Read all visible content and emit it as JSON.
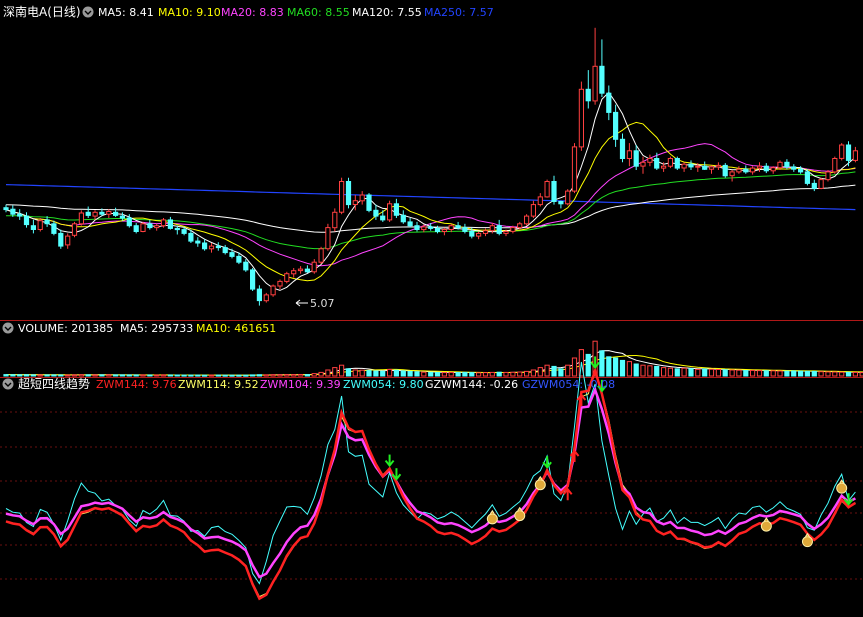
{
  "panels": {
    "price": {
      "title": "深南电A(日线)",
      "indicators": [
        {
          "label": "MA5: ",
          "value": "8.41",
          "color": "#ffffff"
        },
        {
          "label": "MA10: ",
          "value": "9.10",
          "color": "#ffff00"
        },
        {
          "label": "MA20: ",
          "value": "8.83",
          "color": "#ff44ff"
        },
        {
          "label": "MA60: ",
          "value": "8.55",
          "color": "#22dd22"
        },
        {
          "label": "MA120: ",
          "value": "7.55",
          "color": "#ffffff"
        },
        {
          "label": "MA250: ",
          "value": "7.57",
          "color": "#2244ff"
        }
      ],
      "low_marker": "5.07"
    },
    "volume": {
      "indicators": [
        {
          "label": "VOLUME: ",
          "value": "201385",
          "color": "#ffffff"
        },
        {
          "label": "MA5: ",
          "value": "295733",
          "color": "#ffffff"
        },
        {
          "label": "MA10: ",
          "value": "461651",
          "color": "#ffff00"
        }
      ]
    },
    "indicator": {
      "title": "超短四线趋势",
      "indicators": [
        {
          "label": "ZWM144: ",
          "value": "9.76",
          "color": "#ff2222"
        },
        {
          "label": "ZWM114: ",
          "value": "9.52",
          "color": "#ffff66"
        },
        {
          "label": "ZWM104: ",
          "value": "9.39",
          "color": "#ff44ff"
        },
        {
          "label": "ZWM054: ",
          "value": "9.80",
          "color": "#44ffff"
        },
        {
          "label": "GZWM144: ",
          "value": "-0.26",
          "color": "#ffffff"
        },
        {
          "label": "GZWM054: ",
          "value": "-0.08",
          "color": "#3355ff"
        }
      ]
    }
  },
  "colors": {
    "up": "#ff4040",
    "down": "#54ffff",
    "separator": "#b01818",
    "grid": "#6a0f0f",
    "background": "#000000"
  },
  "icons": {
    "panel_toggle": "chevron-circle-icon",
    "buy_arrow": "red-up-arrow-icon",
    "sell_arrow": "green-down-arrow-icon",
    "money_bag": "money-bag-icon"
  },
  "chart_data": [
    {
      "type": "candlestick",
      "series": [
        {
          "name": "MA5",
          "color": "#ffffff"
        },
        {
          "name": "MA10",
          "color": "#ffff00"
        },
        {
          "name": "MA20",
          "color": "#ff44ff"
        },
        {
          "name": "MA60",
          "color": "#22dd22"
        },
        {
          "name": "MA120",
          "color": "#ffffff"
        },
        {
          "name": "MA250",
          "color": "#2244ff"
        }
      ],
      "ylim": [
        4.8,
        12.4
      ],
      "ohlc": [
        [
          7.62,
          7.7,
          7.5,
          7.57
        ],
        [
          7.58,
          7.68,
          7.38,
          7.45
        ],
        [
          7.45,
          7.58,
          7.3,
          7.4
        ],
        [
          7.4,
          7.5,
          7.1,
          7.18
        ],
        [
          7.15,
          7.3,
          6.95,
          7.05
        ],
        [
          7.05,
          7.35,
          7.0,
          7.28
        ],
        [
          7.3,
          7.4,
          7.12,
          7.2
        ],
        [
          7.2,
          7.28,
          6.9,
          6.95
        ],
        [
          6.95,
          7.05,
          6.55,
          6.62
        ],
        [
          6.65,
          6.95,
          6.55,
          6.88
        ],
        [
          6.9,
          7.25,
          6.85,
          7.2
        ],
        [
          7.2,
          7.55,
          7.15,
          7.48
        ],
        [
          7.5,
          7.65,
          7.35,
          7.42
        ],
        [
          7.4,
          7.55,
          7.3,
          7.5
        ],
        [
          7.5,
          7.6,
          7.4,
          7.45
        ],
        [
          7.45,
          7.58,
          7.35,
          7.52
        ],
        [
          7.5,
          7.62,
          7.38,
          7.42
        ],
        [
          7.4,
          7.5,
          7.28,
          7.35
        ],
        [
          7.35,
          7.45,
          7.1,
          7.15
        ],
        [
          7.15,
          7.22,
          6.95,
          7.0
        ],
        [
          7.0,
          7.25,
          6.98,
          7.2
        ],
        [
          7.2,
          7.3,
          7.05,
          7.1
        ],
        [
          7.1,
          7.2,
          7.02,
          7.15
        ],
        [
          7.15,
          7.35,
          7.1,
          7.3
        ],
        [
          7.3,
          7.38,
          7.05,
          7.08
        ],
        [
          7.08,
          7.15,
          6.92,
          7.05
        ],
        [
          7.05,
          7.12,
          6.9,
          6.95
        ],
        [
          6.95,
          7.05,
          6.7,
          6.75
        ],
        [
          6.75,
          6.85,
          6.6,
          6.7
        ],
        [
          6.7,
          6.8,
          6.5,
          6.55
        ],
        [
          6.55,
          6.7,
          6.45,
          6.62
        ],
        [
          6.62,
          6.72,
          6.5,
          6.58
        ],
        [
          6.58,
          6.65,
          6.4,
          6.45
        ],
        [
          6.45,
          6.55,
          6.3,
          6.35
        ],
        [
          6.35,
          6.45,
          6.15,
          6.2
        ],
        [
          6.2,
          6.28,
          5.95,
          6.0
        ],
        [
          6.0,
          6.05,
          5.45,
          5.5
        ],
        [
          5.5,
          5.6,
          5.07,
          5.2
        ],
        [
          5.2,
          5.4,
          5.15,
          5.35
        ],
        [
          5.35,
          5.62,
          5.3,
          5.58
        ],
        [
          5.58,
          5.75,
          5.5,
          5.7
        ],
        [
          5.7,
          5.95,
          5.65,
          5.9
        ],
        [
          5.9,
          6.05,
          5.8,
          5.98
        ],
        [
          5.98,
          6.1,
          5.9,
          6.02
        ],
        [
          6.02,
          6.12,
          5.92,
          5.95
        ],
        [
          5.95,
          6.28,
          5.9,
          6.2
        ],
        [
          6.2,
          6.6,
          6.15,
          6.55
        ],
        [
          6.55,
          7.2,
          6.5,
          7.1
        ],
        [
          7.1,
          7.6,
          7.0,
          7.5
        ],
        [
          7.5,
          8.4,
          7.45,
          8.3
        ],
        [
          8.3,
          8.4,
          7.6,
          7.7
        ],
        [
          7.7,
          7.95,
          7.55,
          7.8
        ],
        [
          7.8,
          8.05,
          7.7,
          7.95
        ],
        [
          7.95,
          8.0,
          7.5,
          7.55
        ],
        [
          7.55,
          7.7,
          7.3,
          7.4
        ],
        [
          7.4,
          7.55,
          7.25,
          7.3
        ],
        [
          7.3,
          7.8,
          7.25,
          7.72
        ],
        [
          7.72,
          7.85,
          7.35,
          7.42
        ],
        [
          7.42,
          7.55,
          7.2,
          7.25
        ],
        [
          7.25,
          7.35,
          7.1,
          7.15
        ],
        [
          7.15,
          7.25,
          7.0,
          7.05
        ],
        [
          7.05,
          7.18,
          6.98,
          7.12
        ],
        [
          7.12,
          7.22,
          7.02,
          7.08
        ],
        [
          7.08,
          7.15,
          6.95,
          7.0
        ],
        [
          7.0,
          7.1,
          6.9,
          7.05
        ],
        [
          7.05,
          7.2,
          6.98,
          7.15
        ],
        [
          7.15,
          7.25,
          7.05,
          7.1
        ],
        [
          7.1,
          7.2,
          6.95,
          7.0
        ],
        [
          7.0,
          7.1,
          6.82,
          6.88
        ],
        [
          6.88,
          7.0,
          6.8,
          6.95
        ],
        [
          6.95,
          7.08,
          6.88,
          7.02
        ],
        [
          7.02,
          7.22,
          6.95,
          7.15
        ],
        [
          7.15,
          7.3,
          6.9,
          6.95
        ],
        [
          6.95,
          7.05,
          6.88,
          7.0
        ],
        [
          7.0,
          7.15,
          6.95,
          7.1
        ],
        [
          7.1,
          7.25,
          7.05,
          7.2
        ],
        [
          7.2,
          7.45,
          7.15,
          7.4
        ],
        [
          7.4,
          7.8,
          7.35,
          7.7
        ],
        [
          7.7,
          8.0,
          7.65,
          7.9
        ],
        [
          7.9,
          8.35,
          7.88,
          8.3
        ],
        [
          8.3,
          8.45,
          7.7,
          7.78
        ],
        [
          7.78,
          7.8,
          7.6,
          7.72
        ],
        [
          7.72,
          8.1,
          7.68,
          8.05
        ],
        [
          8.05,
          9.3,
          8.0,
          9.2
        ],
        [
          9.2,
          10.9,
          9.1,
          10.7
        ],
        [
          10.7,
          11.2,
          10.2,
          10.4
        ],
        [
          10.4,
          12.3,
          10.3,
          11.3
        ],
        [
          11.3,
          12.0,
          10.5,
          10.6
        ],
        [
          10.6,
          10.8,
          9.9,
          10.1
        ],
        [
          10.1,
          10.3,
          9.2,
          9.4
        ],
        [
          9.4,
          9.55,
          8.8,
          8.9
        ],
        [
          8.9,
          9.3,
          8.7,
          9.1
        ],
        [
          9.1,
          9.25,
          8.6,
          8.7
        ],
        [
          8.7,
          8.95,
          8.5,
          8.8
        ],
        [
          8.8,
          9.0,
          8.7,
          8.9
        ],
        [
          8.9,
          9.05,
          8.6,
          8.65
        ],
        [
          8.65,
          8.8,
          8.55,
          8.7
        ],
        [
          8.7,
          8.95,
          8.65,
          8.9
        ],
        [
          8.9,
          8.95,
          8.6,
          8.65
        ],
        [
          8.65,
          8.8,
          8.55,
          8.75
        ],
        [
          8.75,
          8.85,
          8.6,
          8.68
        ],
        [
          8.68,
          8.78,
          8.55,
          8.7
        ],
        [
          8.7,
          8.82,
          8.6,
          8.62
        ],
        [
          8.62,
          8.72,
          8.5,
          8.68
        ],
        [
          8.68,
          8.8,
          8.6,
          8.72
        ],
        [
          8.72,
          8.78,
          8.4,
          8.45
        ],
        [
          8.45,
          8.6,
          8.3,
          8.55
        ],
        [
          8.55,
          8.7,
          8.5,
          8.62
        ],
        [
          8.62,
          8.72,
          8.5,
          8.55
        ],
        [
          8.55,
          8.7,
          8.48,
          8.65
        ],
        [
          8.65,
          8.8,
          8.55,
          8.7
        ],
        [
          8.7,
          8.78,
          8.52,
          8.58
        ],
        [
          8.58,
          8.7,
          8.5,
          8.66
        ],
        [
          8.66,
          8.85,
          8.6,
          8.8
        ],
        [
          8.8,
          8.88,
          8.62,
          8.68
        ],
        [
          8.68,
          8.75,
          8.55,
          8.62
        ],
        [
          8.62,
          8.7,
          8.5,
          8.55
        ],
        [
          8.55,
          8.62,
          8.2,
          8.25
        ],
        [
          8.25,
          8.35,
          8.05,
          8.12
        ],
        [
          8.12,
          8.4,
          8.1,
          8.35
        ],
        [
          8.35,
          8.6,
          8.3,
          8.55
        ],
        [
          8.55,
          8.95,
          8.5,
          8.9
        ],
        [
          8.9,
          9.3,
          8.85,
          9.25
        ],
        [
          9.25,
          9.35,
          8.7,
          8.85
        ],
        [
          8.85,
          9.2,
          8.8,
          9.1
        ]
      ],
      "ma250_ends": [
        8.22,
        7.57
      ]
    },
    {
      "type": "bar",
      "series": [
        {
          "name": "VOLUME",
          "color": "#ff4040"
        },
        {
          "name": "MA5",
          "color": "#ffffff"
        },
        {
          "name": "MA10",
          "color": "#ffff00"
        }
      ],
      "ylim": [
        0,
        3000000
      ],
      "volumes": [
        120000,
        110000,
        100000,
        105000,
        95000,
        90000,
        88000,
        92000,
        85000,
        80000,
        95000,
        110000,
        100000,
        95000,
        90000,
        98000,
        92000,
        88000,
        85000,
        80000,
        90000,
        85000,
        83000,
        88000,
        86000,
        80000,
        78000,
        75000,
        72000,
        70000,
        75000,
        72000,
        70000,
        68000,
        65000,
        70000,
        90000,
        110000,
        100000,
        105000,
        110000,
        115000,
        120000,
        125000,
        118000,
        200000,
        300000,
        500000,
        700000,
        900000,
        600000,
        500000,
        480000,
        450000,
        420000,
        400000,
        550000,
        480000,
        420000,
        380000,
        350000,
        320000,
        300000,
        290000,
        280000,
        300000,
        290000,
        300000,
        280000,
        270000,
        280000,
        300000,
        320000,
        300000,
        310000,
        330000,
        380000,
        500000,
        700000,
        900000,
        800000,
        600000,
        900000,
        1500000,
        2200000,
        1800000,
        2900000,
        2100000,
        1600000,
        1500000,
        1300000,
        1200000,
        1000000,
        900000,
        850000,
        800000,
        700000,
        650000,
        600000,
        650000,
        600000,
        550000,
        580000,
        560000,
        540000,
        520000,
        500000,
        480000,
        460000,
        470000,
        450000,
        440000,
        430000,
        420000,
        410000,
        420000,
        400000,
        390000,
        380000,
        360000,
        340000,
        330000,
        320000,
        310000,
        300000,
        280000,
        260000,
        201385
      ]
    },
    {
      "type": "line",
      "series": [
        {
          "name": "ZWM144",
          "color": "#ff2222"
        },
        {
          "name": "ZWM114",
          "color": "#ffff66"
        },
        {
          "name": "ZWM104",
          "color": "#ff44ff"
        },
        {
          "name": "ZWM054",
          "color": "#44ffff"
        }
      ],
      "ylim": [
        -14,
        20
      ]
    }
  ]
}
